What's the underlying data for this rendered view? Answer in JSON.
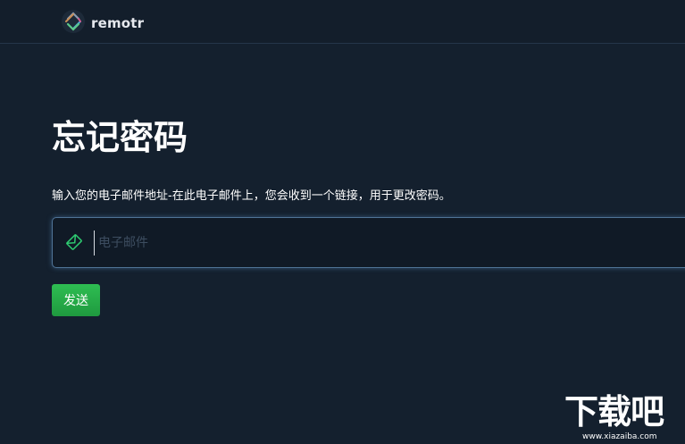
{
  "header": {
    "logo_text": "remotr"
  },
  "main": {
    "title": "忘记密码",
    "description": "输入您的电子邮件地址-在此电子邮件上，您会收到一个链接，用于更改密码。",
    "email_field": {
      "placeholder": "电子邮件",
      "value": "",
      "icon": "envelope-icon"
    },
    "send_label": "发送"
  },
  "watermark": {
    "logo_text": "下载吧",
    "url": "www.xiazaiba.com"
  },
  "colors": {
    "background": "#14202e",
    "accent_green": "#27ae4a",
    "icon_green": "#2ecc71",
    "field_border": "#4f7396"
  }
}
